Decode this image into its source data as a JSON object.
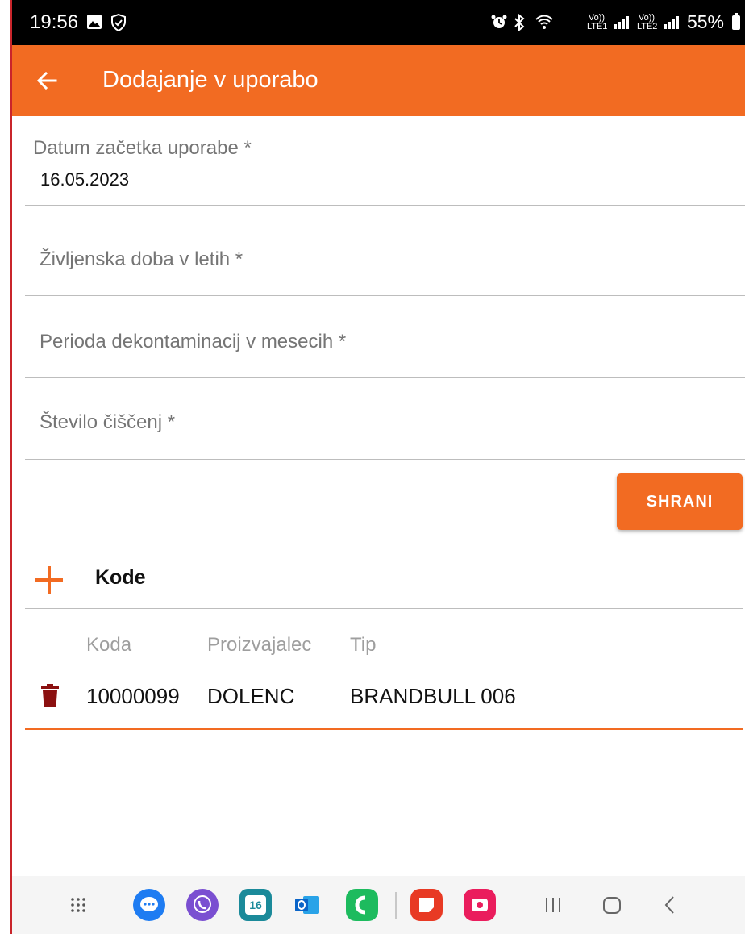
{
  "status_bar": {
    "time": "19:56",
    "battery": "55%",
    "icons": [
      "image-icon",
      "shield-icon",
      "alarm-icon",
      "bluetooth-icon",
      "wifi-icon",
      "signal-icon",
      "battery-icon"
    ],
    "sim1": "Vo)) LTE1",
    "sim2": "Vo)) LTE2"
  },
  "app_bar": {
    "title": "Dodajanje v uporabo",
    "back_icon": "arrow-back-icon",
    "color": "#f26b22"
  },
  "form": {
    "start_date": {
      "label": "Datum začetka uporabe *",
      "value": "16.05.2023"
    },
    "lifetime_years": {
      "label": "Življenska doba v letih *",
      "value": ""
    },
    "decontamination_period": {
      "label": "Perioda dekontaminacij v mesecih *",
      "value": ""
    },
    "cleaning_count": {
      "label": "Število čiščenj *",
      "value": ""
    },
    "save_label": "SHRANI"
  },
  "codes": {
    "title": "Kode",
    "add_icon": "plus-icon",
    "columns": [
      "Koda",
      "Proizvajalec",
      "Tip"
    ],
    "rows": [
      {
        "code": "10000099",
        "manufacturer": "DOLENC",
        "type": "BRANDBULL 006",
        "delete_icon": "trash-icon"
      }
    ]
  },
  "nav_bar": {
    "items": [
      "apps-grid-icon",
      "messages-icon",
      "viber-icon",
      "calendar-icon",
      "outlook-icon",
      "phone-app-icon",
      "notes-app-icon",
      "camera-app-icon",
      "recents-icon",
      "home-icon",
      "back-icon"
    ],
    "calendar_day": "16"
  }
}
